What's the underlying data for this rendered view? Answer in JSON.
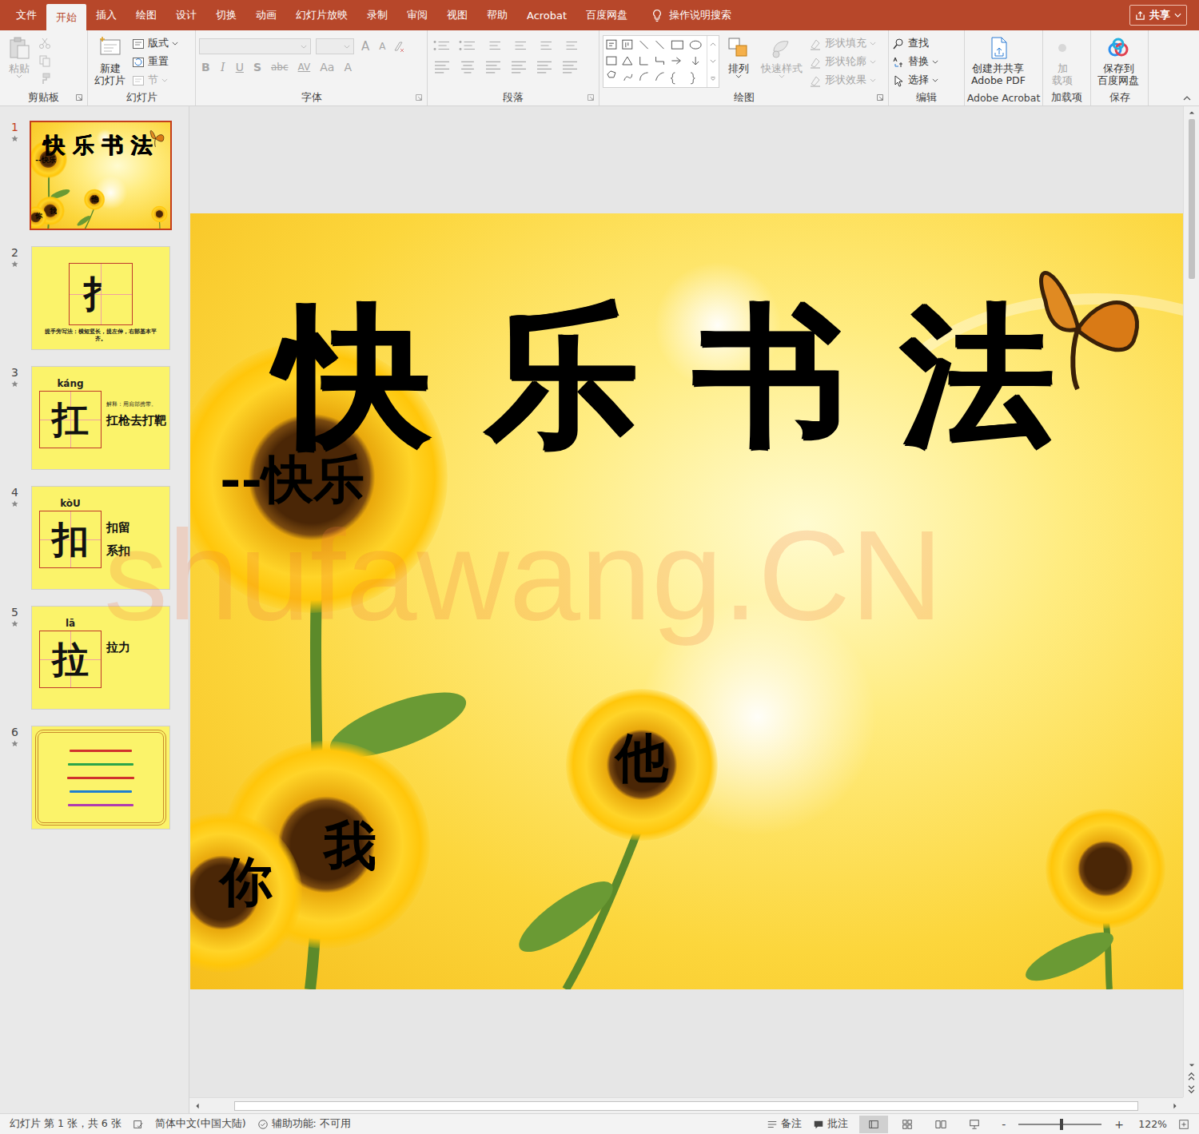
{
  "tabs": [
    {
      "label": "文件",
      "selected": false
    },
    {
      "label": "开始",
      "selected": true
    },
    {
      "label": "插入",
      "selected": false
    },
    {
      "label": "绘图",
      "selected": false
    },
    {
      "label": "设计",
      "selected": false
    },
    {
      "label": "切换",
      "selected": false
    },
    {
      "label": "动画",
      "selected": false
    },
    {
      "label": "幻灯片放映",
      "selected": false
    },
    {
      "label": "录制",
      "selected": false
    },
    {
      "label": "审阅",
      "selected": false
    },
    {
      "label": "视图",
      "selected": false
    },
    {
      "label": "帮助",
      "selected": false
    },
    {
      "label": "Acrobat",
      "selected": false
    },
    {
      "label": "百度网盘",
      "selected": false
    }
  ],
  "search": {
    "label": "操作说明搜索"
  },
  "share": {
    "label": "共享"
  },
  "ribbon": {
    "clipboard": {
      "label": "剪贴板",
      "paste": {
        "label": "粘贴",
        "disabled": true
      },
      "tools_disabled": true
    },
    "slides": {
      "label": "幻灯片",
      "new_slide": {
        "lines": [
          "新建",
          "幻灯片"
        ]
      },
      "items": [
        {
          "label": "版式",
          "disabled": false
        },
        {
          "label": "重置",
          "disabled": false
        },
        {
          "label": "节",
          "disabled": true
        }
      ]
    },
    "font": {
      "label": "字体",
      "disabled": true,
      "size_buttons": [
        "A",
        "A"
      ],
      "buttons": [
        "B",
        "I",
        "U",
        "S",
        "abc",
        "AV",
        "Aa",
        "A"
      ]
    },
    "paragraph": {
      "label": "段落",
      "disabled": true
    },
    "drawing": {
      "label": "绘图",
      "arrange": {
        "label": "排列",
        "disabled": false
      },
      "quick_styles": {
        "label": "快速样式",
        "disabled": true
      },
      "options": [
        {
          "label": "形状填充",
          "disabled": true
        },
        {
          "label": "形状轮廓",
          "disabled": true
        },
        {
          "label": "形状效果",
          "disabled": true
        }
      ]
    },
    "editing": {
      "label": "编辑",
      "items": [
        {
          "label": "查找"
        },
        {
          "label": "替换"
        },
        {
          "label": "选择"
        }
      ]
    },
    "acrobat": {
      "label": "Adobe Acrobat",
      "button": [
        "创建并共享",
        "Adobe PDF"
      ]
    },
    "addins": {
      "label": "加载项",
      "button": {
        "lines": [
          "加",
          "载项"
        ],
        "disabled": true
      }
    },
    "save": {
      "label": "保存",
      "button": [
        "保存到",
        "百度网盘"
      ]
    }
  },
  "slides": [
    {
      "number": "1",
      "selected": true,
      "animated": true,
      "kind": "title"
    },
    {
      "number": "2",
      "selected": false,
      "animated": true,
      "kind": "stroke",
      "glyph": "扌",
      "note": "提手旁写法：横短竖长，提左伸，右部基本平齐。"
    },
    {
      "number": "3",
      "selected": false,
      "animated": true,
      "kind": "char",
      "pinyin": "káng",
      "glyph": "扛",
      "words": [
        {
          "text": "解释：用肩部携带。",
          "kind": "note"
        },
        {
          "text": "扛枪去打靶",
          "kind": "word"
        }
      ]
    },
    {
      "number": "4",
      "selected": false,
      "animated": true,
      "kind": "char",
      "pinyin": "kòU",
      "glyph": "扣",
      "words": [
        {
          "text": "扣留",
          "kind": "word"
        },
        {
          "text": "系扣",
          "kind": "word"
        }
      ]
    },
    {
      "number": "5",
      "selected": false,
      "animated": true,
      "kind": "char",
      "pinyin": "lā",
      "glyph": "拉",
      "words": [
        {
          "text": "拉力",
          "kind": "word"
        }
      ]
    },
    {
      "number": "6",
      "selected": false,
      "animated": true,
      "kind": "poem",
      "lines": [
        {
          "color": "#d0312d",
          "level": 0.5
        },
        {
          "color": "#2aa54a",
          "level": 0.52
        },
        {
          "color": "#d0312d",
          "level": 0.54
        },
        {
          "color": "#1e7fd0",
          "level": 0.5
        },
        {
          "color": "#b03ab0",
          "level": 0.52
        }
      ]
    }
  ],
  "current_slide": {
    "title": "快乐书法",
    "subtitle": "--快乐",
    "words": [
      {
        "text": "他"
      },
      {
        "text": "我"
      },
      {
        "text": "你"
      }
    ]
  },
  "watermark": "shufawang.CN",
  "scrollbars": {
    "vertical_start": 0,
    "vertical_size": 0.17,
    "horizontal_start": 0.03,
    "horizontal_size": 0.94
  },
  "status_bar": {
    "slide_info": "幻灯片 第 1 张，共 6 张",
    "language": "简体中文(中国大陆)",
    "accessibility": "辅助功能: 不可用",
    "notes": "备注",
    "comments": "批注",
    "views": [
      {
        "selected": true
      },
      {
        "selected": false
      },
      {
        "selected": false
      },
      {
        "selected": false
      }
    ],
    "zoom": {
      "minus": "-",
      "plus": "+",
      "level": 0.52,
      "reading": "122%"
    }
  }
}
